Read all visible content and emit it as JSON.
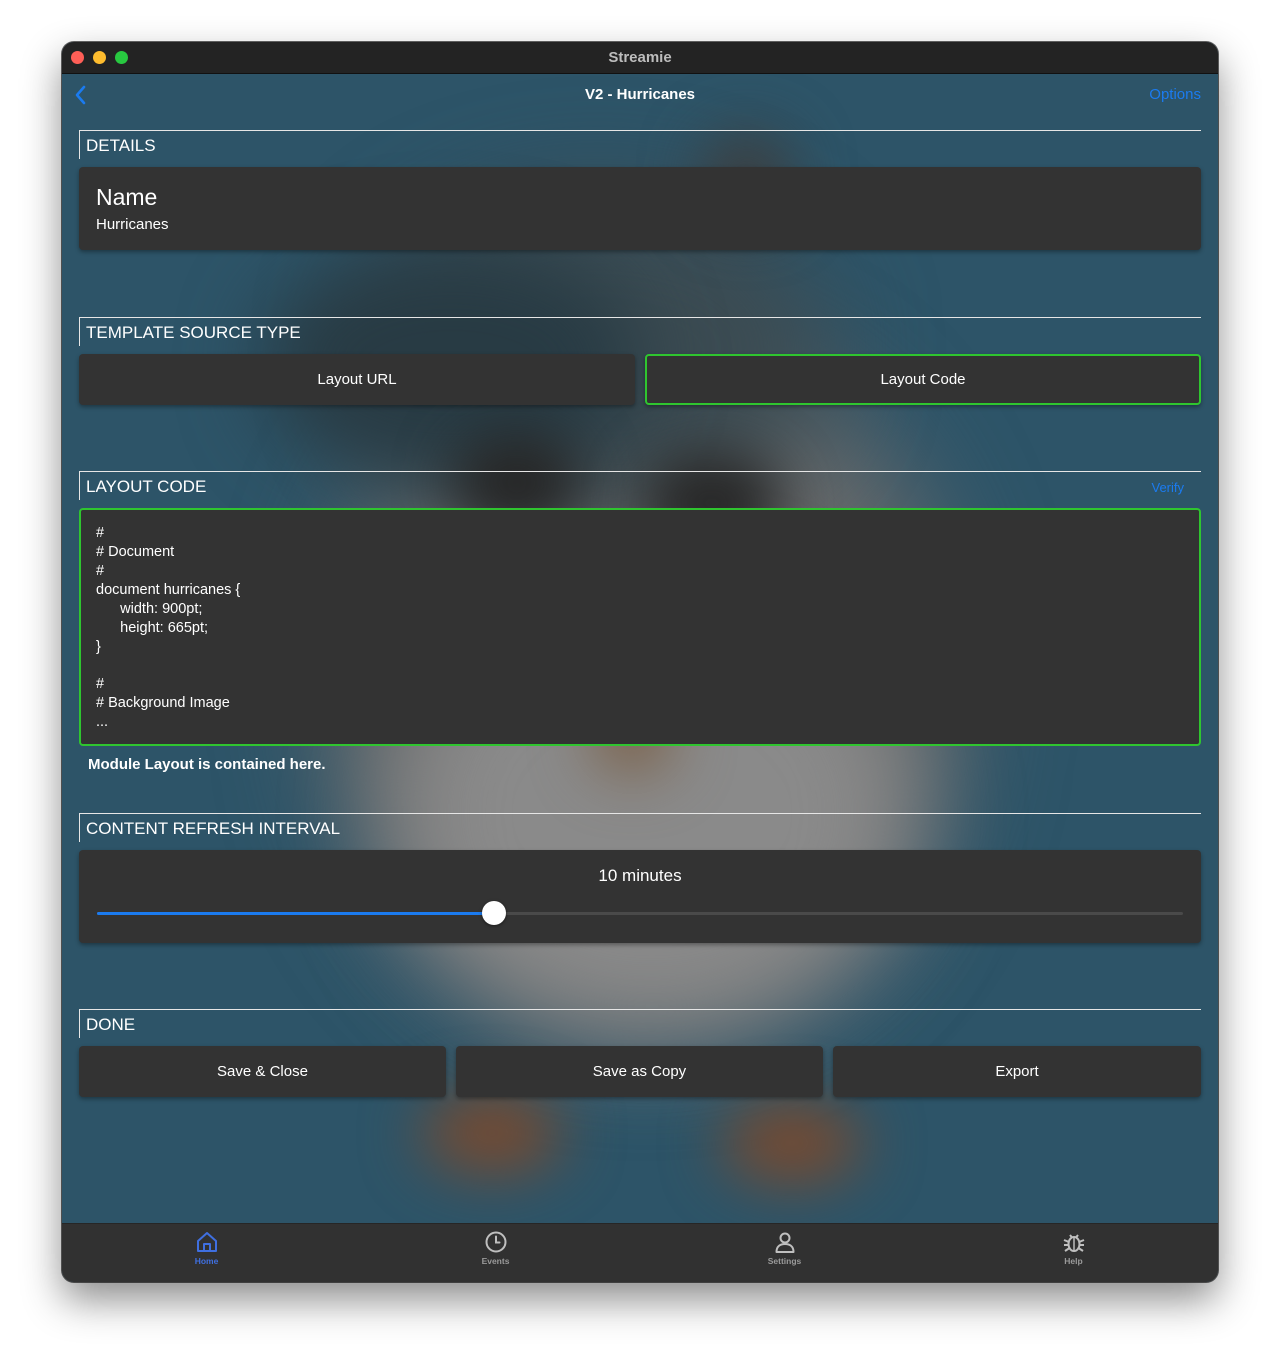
{
  "window": {
    "title": "Streamie"
  },
  "nav": {
    "title": "V2 - Hurricanes",
    "options_label": "Options"
  },
  "details": {
    "header": "DETAILS",
    "name_label": "Name",
    "name_value": "Hurricanes"
  },
  "template_source": {
    "header": "TEMPLATE SOURCE TYPE",
    "options": [
      "Layout URL",
      "Layout Code"
    ],
    "selected": "Layout Code"
  },
  "layout_code": {
    "header": "LAYOUT CODE",
    "verify_label": "Verify",
    "lines": [
      "#",
      "# Document",
      "#",
      "document hurricanes {",
      "      width: 900pt;",
      "      height: 665pt;",
      "}",
      "",
      "#",
      "# Background Image",
      "..."
    ],
    "helper_text": "Module Layout is contained here."
  },
  "refresh": {
    "header": "CONTENT REFRESH INTERVAL",
    "value_label": "10 minutes",
    "slider_fraction": 0.366
  },
  "done": {
    "header": "DONE",
    "save_close": "Save & Close",
    "save_copy": "Save as Copy",
    "export": "Export"
  },
  "tabs": [
    {
      "label": "Home",
      "icon": "home-icon",
      "active": true
    },
    {
      "label": "Events",
      "icon": "clock-icon",
      "active": false
    },
    {
      "label": "Settings",
      "icon": "person-icon",
      "active": false
    },
    {
      "label": "Help",
      "icon": "bug-icon",
      "active": false
    }
  ],
  "colors": {
    "background": "#2d5468",
    "card": "#333333",
    "accent": "#1b7bf0",
    "selected_border": "#2fc52f",
    "tab_active": "#3f6fe0"
  }
}
